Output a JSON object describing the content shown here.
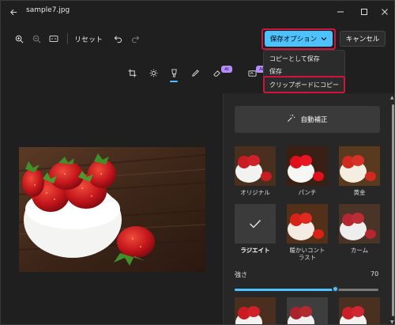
{
  "window": {
    "title": "sample7.jpg"
  },
  "toolbar": {
    "reset_label": "リセット",
    "save_options_label": "保存オプション",
    "cancel_label": "キャンセル"
  },
  "dropdown": {
    "items": [
      "コピーとして保存",
      "保存",
      "クリップボードにコピー"
    ]
  },
  "tools": {
    "ai_badge": "AI"
  },
  "panel": {
    "auto_fix_label": "自動補正",
    "filters": [
      {
        "label": "オリジナル"
      },
      {
        "label": "パンチ"
      },
      {
        "label": "黄金"
      },
      {
        "label": "ラジエイト",
        "selected": true
      },
      {
        "label": "暖かいコントラスト"
      },
      {
        "label": "カーム"
      }
    ],
    "strength_label": "強さ",
    "strength_value": "70",
    "strength_percent": 70
  },
  "colors": {
    "accent": "#4cc2ff",
    "highlight": "#d0143c",
    "ai_badge": "#b48cff"
  }
}
